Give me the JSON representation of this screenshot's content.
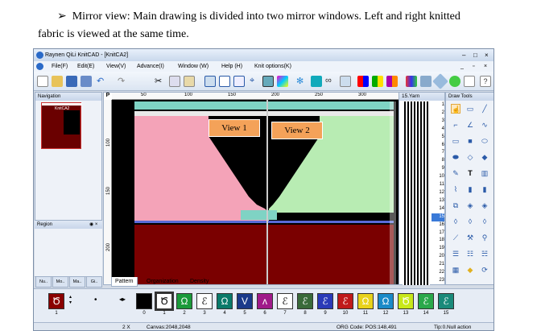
{
  "doc": {
    "bullet": "➢",
    "line1": "Mirror view: Main drawing is divided into two mirror windows. Left and right knitted",
    "line2": "fabric is viewed at the same time."
  },
  "window": {
    "title": "Raynen QiLi KnitCAD - [KnitCA2]",
    "menu": [
      "File(F)",
      "Edit(E)",
      "View(V)",
      "Advance(I)",
      "Window (W)",
      "Help (H)",
      "Knit options(K)"
    ]
  },
  "nav": {
    "title": "Navigation",
    "thumb_label": "KnitCA2"
  },
  "region": {
    "title": "Region"
  },
  "bottom_tabs": [
    "Nu..",
    "Mo..",
    "Ma..",
    "Gi.."
  ],
  "ruler_top": [
    "50",
    "100",
    "150",
    "200",
    "250",
    "300"
  ],
  "ruler_left": [
    "100",
    "150",
    "200"
  ],
  "views": {
    "left": "View 1",
    "right": "View 2"
  },
  "yarn_panel": {
    "title": "15.Yarn"
  },
  "draw_tools": {
    "title": "Draw Tools"
  },
  "row_numbers": [
    "1",
    "2",
    "3",
    "4",
    "5",
    "6",
    "7",
    "8",
    "9",
    "10",
    "11",
    "12",
    "13",
    "14",
    "15",
    "16",
    "17",
    "18",
    "19",
    "20",
    "21",
    "22",
    "23"
  ],
  "pattern_tabs": [
    "Pattern",
    "Organization",
    "Density"
  ],
  "yarn_numbers": [
    "0",
    "1",
    "2",
    "3",
    "4",
    "5",
    "6",
    "7",
    "8",
    "9",
    "10",
    "11",
    "12",
    "13",
    "14",
    "15"
  ],
  "first_yarn_number": "1",
  "status": {
    "zoom": "2 X",
    "canvas": "Canvas:2048,2048",
    "org": "ORG Code: POS:148,491",
    "tip": "Tip:0.Null action"
  },
  "colors": {
    "pink": "#f4a3b8",
    "green": "#b8ecb3",
    "teal": "#7fd3c4",
    "darkred": "#7a0000",
    "orange": "#f4a259"
  }
}
